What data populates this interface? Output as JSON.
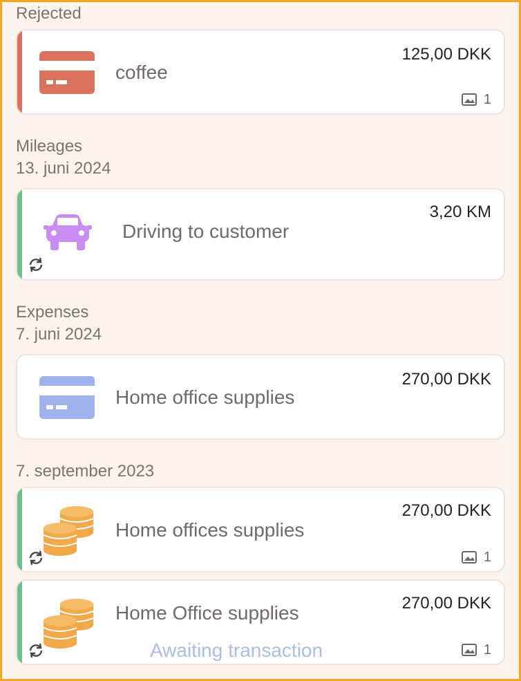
{
  "sections": {
    "rejected": "Rejected",
    "mileages": "Mileages",
    "mileages_date": "13. juni 2024",
    "expenses": "Expenses",
    "expenses_date": "7. juni 2024",
    "older_date": "7. september 2023"
  },
  "items": [
    {
      "title": "coffee",
      "amount": "125,00 DKK",
      "attachments": "1",
      "icon": "credit-card-icon",
      "color": "#d9735d",
      "stripe": "#d9735d"
    },
    {
      "title": "Driving to customer",
      "amount": "3,20 KM",
      "icon": "car-icon",
      "color": "#c98cf0",
      "stripe": "#6dc08a"
    },
    {
      "title": "Home office supplies",
      "amount": "270,00 DKK",
      "icon": "credit-card-icon",
      "color": "#9fb1ea"
    },
    {
      "title": "Home offices supplies",
      "amount": "270,00 DKK",
      "attachments": "1",
      "icon": "coins-icon",
      "color": "#f2a94a",
      "stripe": "#6dc08a"
    },
    {
      "title": "Home Office supplies",
      "amount": "270,00 DKK",
      "attachments": "1",
      "status": "Awaiting transaction",
      "icon": "coins-icon",
      "color": "#f2a94a",
      "stripe": "#6dc08a"
    }
  ]
}
